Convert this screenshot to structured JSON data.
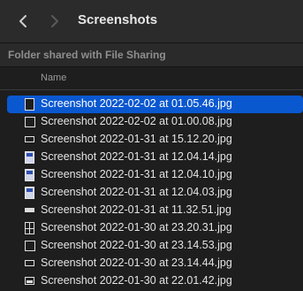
{
  "window": {
    "title": "Screenshots"
  },
  "toolbar": {
    "back_icon": "chevron-left-icon",
    "forward_icon": "chevron-right-icon"
  },
  "shared_bar": {
    "text": "Folder shared with File Sharing"
  },
  "columns": {
    "name": "Name"
  },
  "files": [
    {
      "name": "Screenshot 2022-02-02 at 01.05.46.jpg",
      "icon": "portrait-image-icon",
      "selected": true
    },
    {
      "name": "Screenshot 2022-02-02 at 01.00.08.jpg",
      "icon": "square-image-icon",
      "selected": false
    },
    {
      "name": "Screenshot 2022-01-31 at 15.12.20.jpg",
      "icon": "wide-image-icon",
      "selected": false
    },
    {
      "name": "Screenshot 2022-01-31 at 12.04.14.jpg",
      "icon": "screenshot-image-icon",
      "selected": false
    },
    {
      "name": "Screenshot 2022-01-31 at 12.04.10.jpg",
      "icon": "screenshot-image-icon",
      "selected": false
    },
    {
      "name": "Screenshot 2022-01-31 at 12.04.03.jpg",
      "icon": "screenshot-image-icon",
      "selected": false
    },
    {
      "name": "Screenshot 2022-01-31 at 11.32.51.jpg",
      "icon": "thin-image-icon",
      "selected": false
    },
    {
      "name": "Screenshot 2022-01-30 at 23.20.31.jpg",
      "icon": "grid-image-icon",
      "selected": false
    },
    {
      "name": "Screenshot 2022-01-30 at 23.14.53.jpg",
      "icon": "square-image-icon",
      "selected": false
    },
    {
      "name": "Screenshot 2022-01-30 at 23.14.44.jpg",
      "icon": "wide-image-icon",
      "selected": false
    },
    {
      "name": "Screenshot 2022-01-30 at 22.01.42.jpg",
      "icon": "filled-image-icon",
      "selected": false
    }
  ],
  "colors": {
    "selection": "#0a58d0",
    "background": "#1e1e1e"
  }
}
